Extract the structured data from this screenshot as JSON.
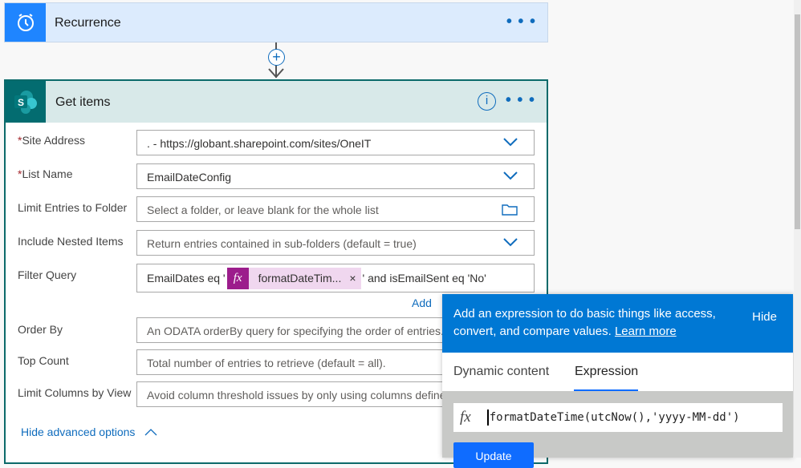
{
  "recurrence": {
    "title": "Recurrence",
    "icon": "alarm-clock-icon",
    "more": "• • •"
  },
  "connector": {
    "add_icon": "plus-circle-icon",
    "arrow_icon": "arrow-down-icon"
  },
  "get_items": {
    "title": "Get items",
    "icon": "sharepoint-icon",
    "info": "i",
    "more": "• • •",
    "fields": [
      {
        "label": "Site Address",
        "required": true,
        "value": ". - https://globant.sharepoint.com/sites/OneIT",
        "control": "dropdown"
      },
      {
        "label": "List Name",
        "required": true,
        "value": "EmailDateConfig",
        "control": "dropdown"
      },
      {
        "label": "Limit Entries to Folder",
        "placeholder": "Select a folder, or leave blank for the whole list",
        "control": "folder-picker"
      },
      {
        "label": "Include Nested Items",
        "value": "Return entries contained in sub-folders (default = true)",
        "control": "dropdown"
      },
      {
        "label": "Filter Query",
        "prefix": "EmailDates eq '",
        "token": "formatDateTim...",
        "suffix": "' and isEmailSent eq 'No'"
      },
      {
        "label": "Order By",
        "placeholder": "An ODATA orderBy query for specifying the order of entries."
      },
      {
        "label": "Top Count",
        "placeholder": "Total number of entries to retrieve (default = all)."
      },
      {
        "label": "Limit Columns by View",
        "placeholder": "Avoid column threshold issues by only using columns defined in a view"
      }
    ],
    "add_link": "Add",
    "hide_advanced": "Hide advanced options"
  },
  "expression_panel": {
    "info": "Add an expression to do basic things like access, convert, and compare values.",
    "learn_more": "Learn more",
    "hide": "Hide",
    "tabs": [
      {
        "label": "Dynamic content",
        "active": false
      },
      {
        "label": "Expression",
        "active": true
      }
    ],
    "expression": "formatDateTime(utcNow(),'yyyy-MM-dd')",
    "button": "Update"
  },
  "colors": {
    "accent": "#0078d4",
    "sharepoint": "#036c70",
    "token": "#9c1d8c"
  }
}
